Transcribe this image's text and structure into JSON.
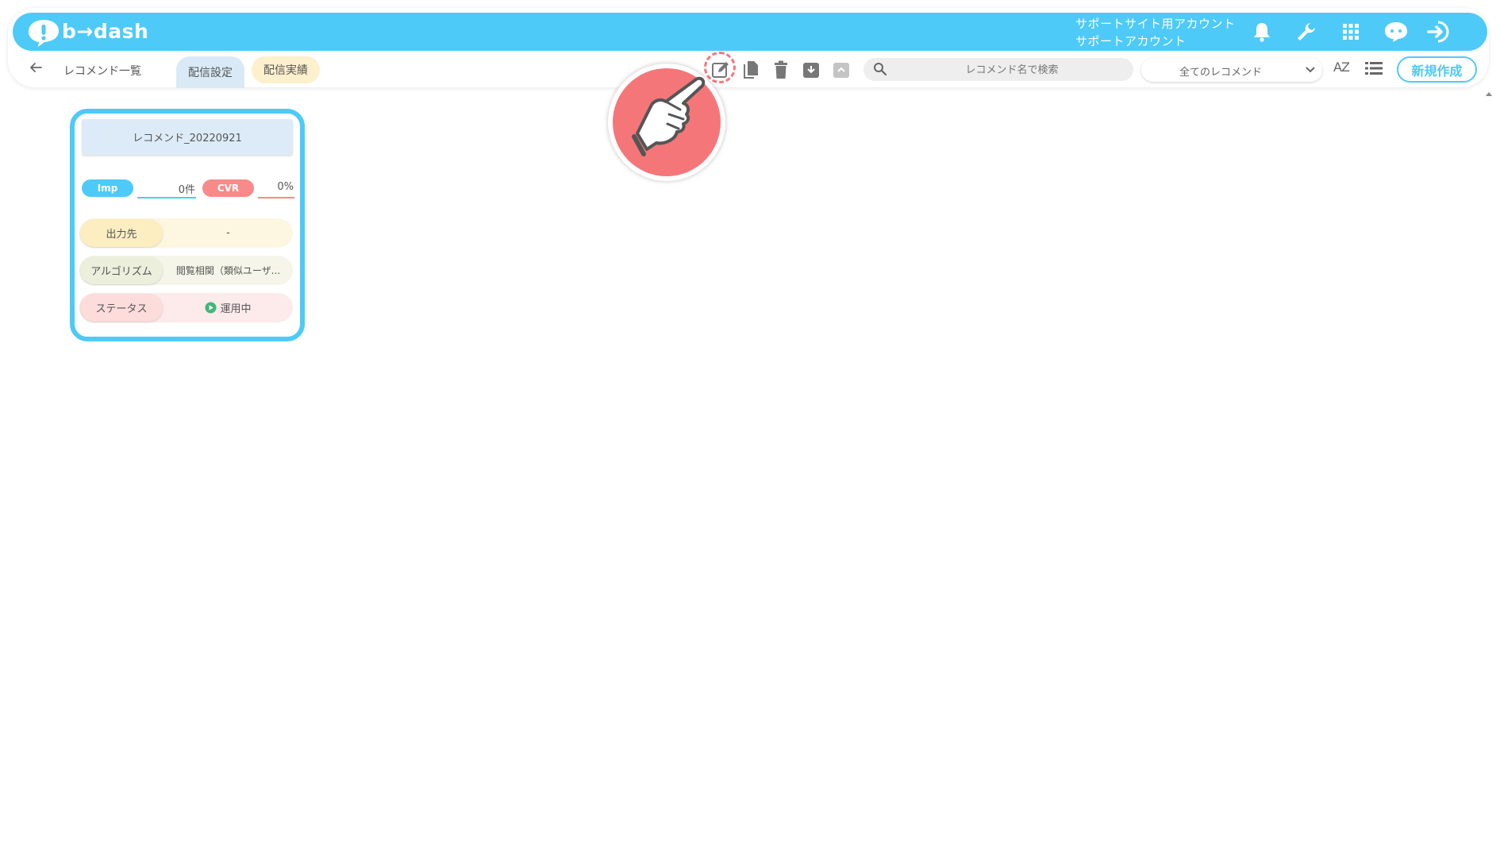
{
  "app": {
    "logo_text": "b→dash"
  },
  "account": {
    "line1": "サポートサイト用アカウント",
    "line2": "サポートアカウント"
  },
  "header_icons": [
    "bell-icon",
    "wrench-icon",
    "apps-grid-icon",
    "chat-icon",
    "logout-icon"
  ],
  "toolbar": {
    "back_label": "レコメンド一覧",
    "tabs": [
      {
        "label": "配信設定",
        "active": true
      },
      {
        "label": "配信実績",
        "active": false
      }
    ],
    "actions": [
      "edit-icon",
      "copy-icon",
      "delete-icon",
      "archive-icon",
      "unarchive-icon"
    ],
    "search_placeholder": "レコメンド名で検索",
    "filter_value": "全てのレコメンド",
    "sort_label": "AZ",
    "new_label": "新規作成"
  },
  "card": {
    "title": "レコメンド_20220921",
    "imp": {
      "label": "Imp",
      "value": "0件"
    },
    "cvr": {
      "label": "CVR",
      "value": "0%"
    },
    "rows": [
      {
        "label": "出力先",
        "value": "-"
      },
      {
        "label": "アルゴリズム",
        "value": "閲覧相関（類似ユーザ..."
      },
      {
        "label": "ステータス",
        "value": "運用中"
      }
    ]
  },
  "colors": {
    "accent": "#4dcaf8",
    "cvr": "#f88a8a",
    "pointer": "#f57679",
    "tab_active": "#d9eaf6",
    "tab_inactive": "#fdf0cc"
  }
}
